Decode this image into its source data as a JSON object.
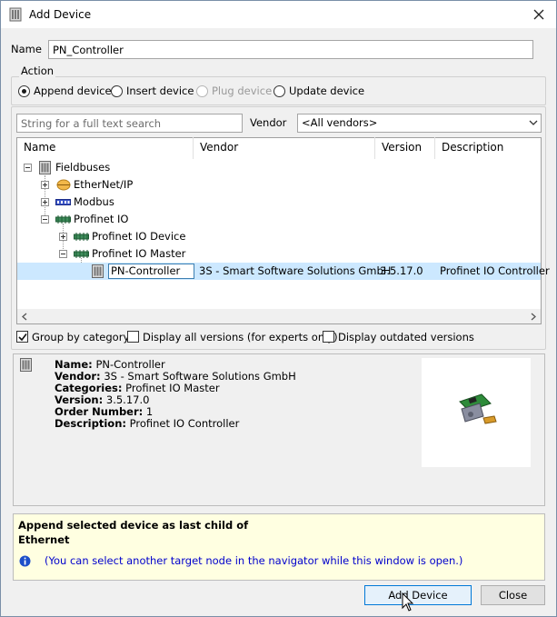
{
  "window": {
    "title": "Add Device"
  },
  "name_field": {
    "label": "Name",
    "value": "PN_Controller"
  },
  "action": {
    "label": "Action",
    "options": [
      {
        "label": "Append device",
        "selected": true,
        "enabled": true
      },
      {
        "label": "Insert device",
        "selected": false,
        "enabled": true
      },
      {
        "label": "Plug device",
        "selected": false,
        "enabled": false
      },
      {
        "label": "Update device",
        "selected": false,
        "enabled": true
      }
    ]
  },
  "search": {
    "placeholder": "String for a full text search",
    "vendor_label": "Vendor",
    "vendor_value": "<All vendors>"
  },
  "tree": {
    "columns": [
      "Name",
      "Vendor",
      "Version",
      "Description"
    ],
    "rows": [
      {
        "name": "Fieldbuses"
      },
      {
        "name": "EtherNet/IP"
      },
      {
        "name": "Modbus"
      },
      {
        "name": "Profinet IO"
      },
      {
        "name": "Profinet IO Device"
      },
      {
        "name": "Profinet IO Master"
      },
      {
        "name": "PN-Controller",
        "vendor": "3S - Smart Software Solutions GmbH",
        "version": "3.5.17.0",
        "description": "Profinet IO Controller"
      }
    ]
  },
  "options": {
    "group_by_category": "Group by category",
    "display_all_versions": "Display all versions (for experts only)",
    "display_outdated": "Display outdated versions"
  },
  "info": {
    "name_label": "Name:",
    "name_value": "PN-Controller",
    "vendor_label": "Vendor:",
    "vendor_value": "3S - Smart Software Solutions GmbH",
    "categories_label": "Categories:",
    "categories_value": "Profinet IO Master",
    "version_label": "Version:",
    "version_value": "3.5.17.0",
    "order_label": "Order Number:",
    "order_value": "1",
    "description_label": "Description:",
    "description_value": "Profinet IO Controller"
  },
  "hint": {
    "line1": "Append selected device as last child of",
    "line2": "Ethernet",
    "note": "(You can select another target node in the navigator while this window is open.)"
  },
  "buttons": {
    "add": "Add Device",
    "close": "Close"
  },
  "colors": {
    "selection": "#cce8ff",
    "hint_bg": "#ffffe1",
    "note_text": "#0000cc"
  }
}
